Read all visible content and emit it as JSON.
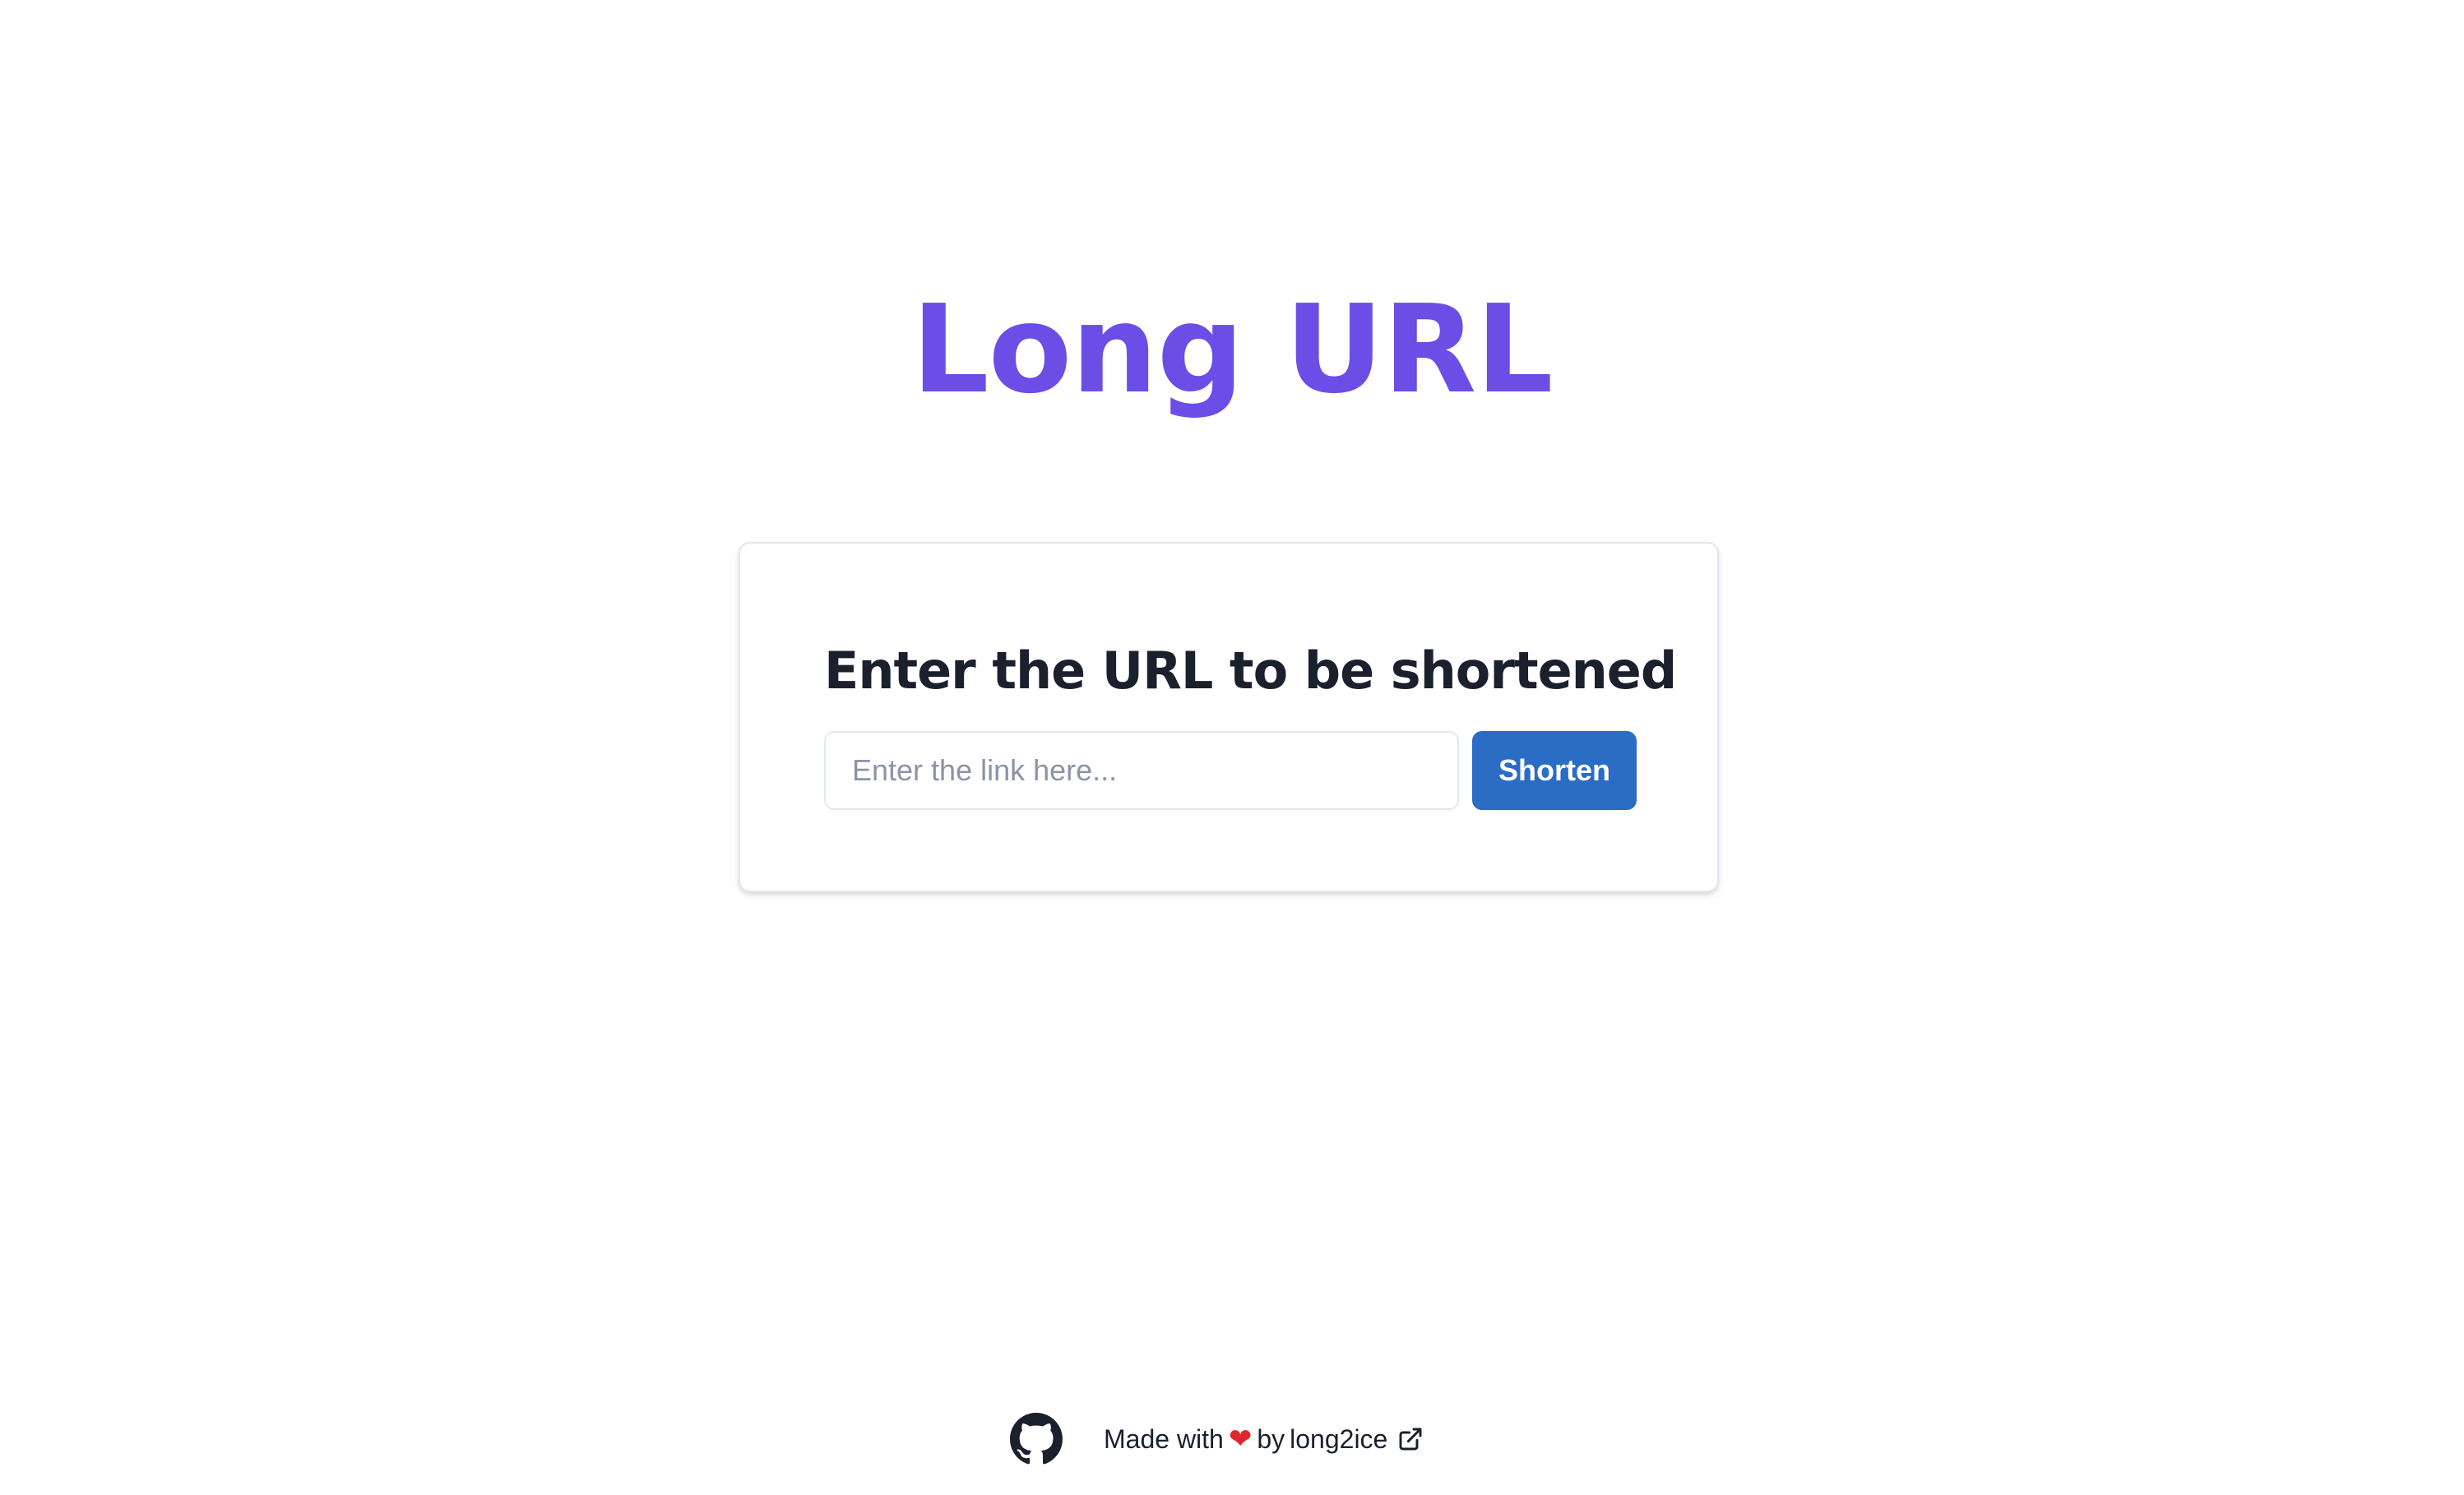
{
  "header": {
    "title": "Long URL"
  },
  "form": {
    "heading": "Enter the URL to be shortened",
    "input_placeholder": "Enter the link here...",
    "input_value": "",
    "submit_label": "Shorten"
  },
  "footer": {
    "made_with": "Made with",
    "by": "by",
    "author": "long2ice",
    "icons": {
      "repo": "github-icon",
      "love": "heart-icon",
      "external": "external-link-icon"
    }
  },
  "colors": {
    "title": "#6b4ee6",
    "button": "#2b6cc4",
    "heart": "#e3262b",
    "text": "#1a202c"
  }
}
